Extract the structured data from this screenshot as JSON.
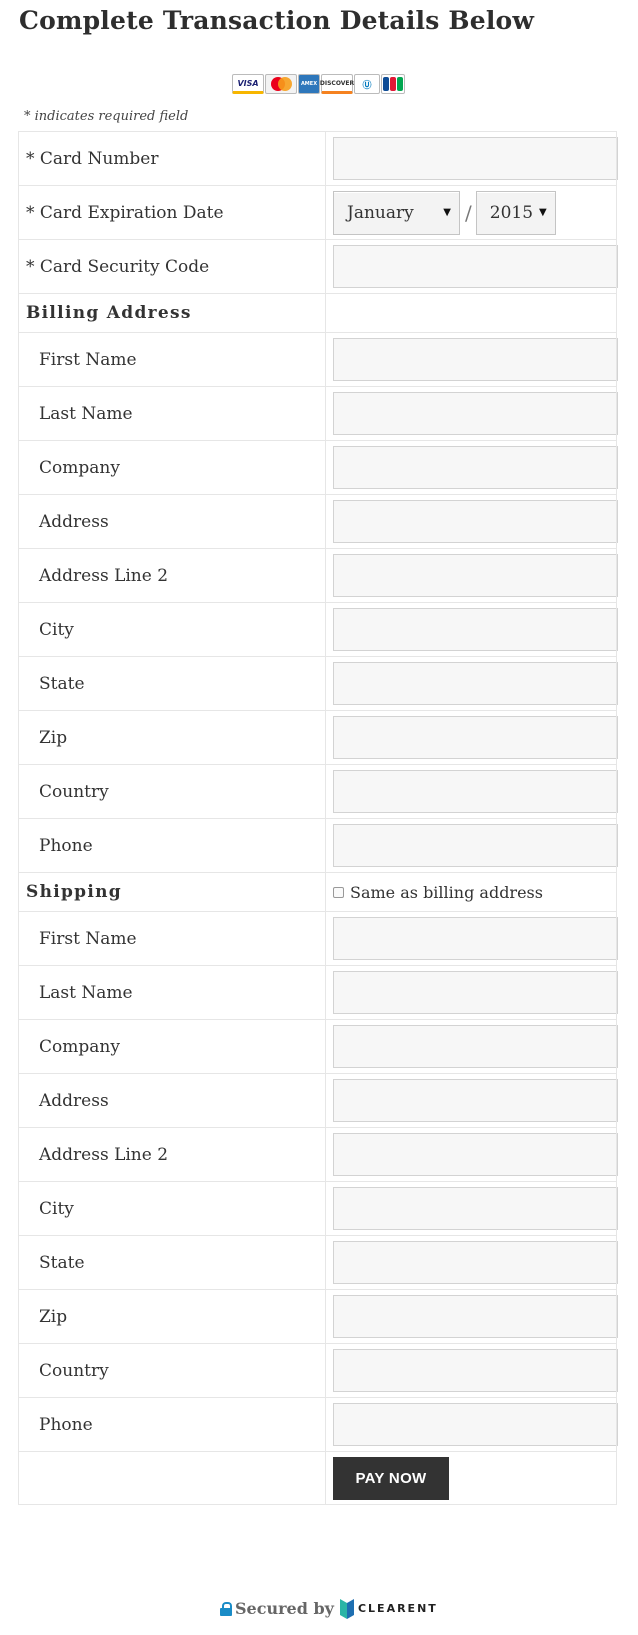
{
  "page": {
    "title": "Complete Transaction Details Below",
    "required_note": "* indicates required field"
  },
  "card_logos": [
    "VISA",
    "MasterCard",
    "AMERICAN EXPRESS",
    "DISCOVER",
    "Diners Club",
    "JCB"
  ],
  "payment": {
    "card_number_label": "* Card Number",
    "expiration_label": "* Card Expiration Date",
    "expiration_month": "January",
    "expiration_separator": "/",
    "expiration_year": "2015",
    "security_code_label": "* Card Security Code"
  },
  "billing": {
    "heading": "Billing Address",
    "fields": [
      "First Name",
      "Last Name",
      "Company",
      "Address",
      "Address Line 2",
      "City",
      "State",
      "Zip",
      "Country",
      "Phone"
    ]
  },
  "shipping": {
    "heading": "Shipping",
    "same_as_billing_label": "Same as billing address",
    "same_as_billing_checked": false,
    "fields": [
      "First Name",
      "Last Name",
      "Company",
      "Address",
      "Address Line 2",
      "City",
      "State",
      "Zip",
      "Country",
      "Phone"
    ]
  },
  "submit": {
    "label": "PAY NOW"
  },
  "footer": {
    "secured_text": "Secured by",
    "brand": "CLEARENT"
  },
  "icons": [
    "lock-icon",
    "clearent-logo",
    "dropdown-arrow-icon",
    "checkbox"
  ]
}
